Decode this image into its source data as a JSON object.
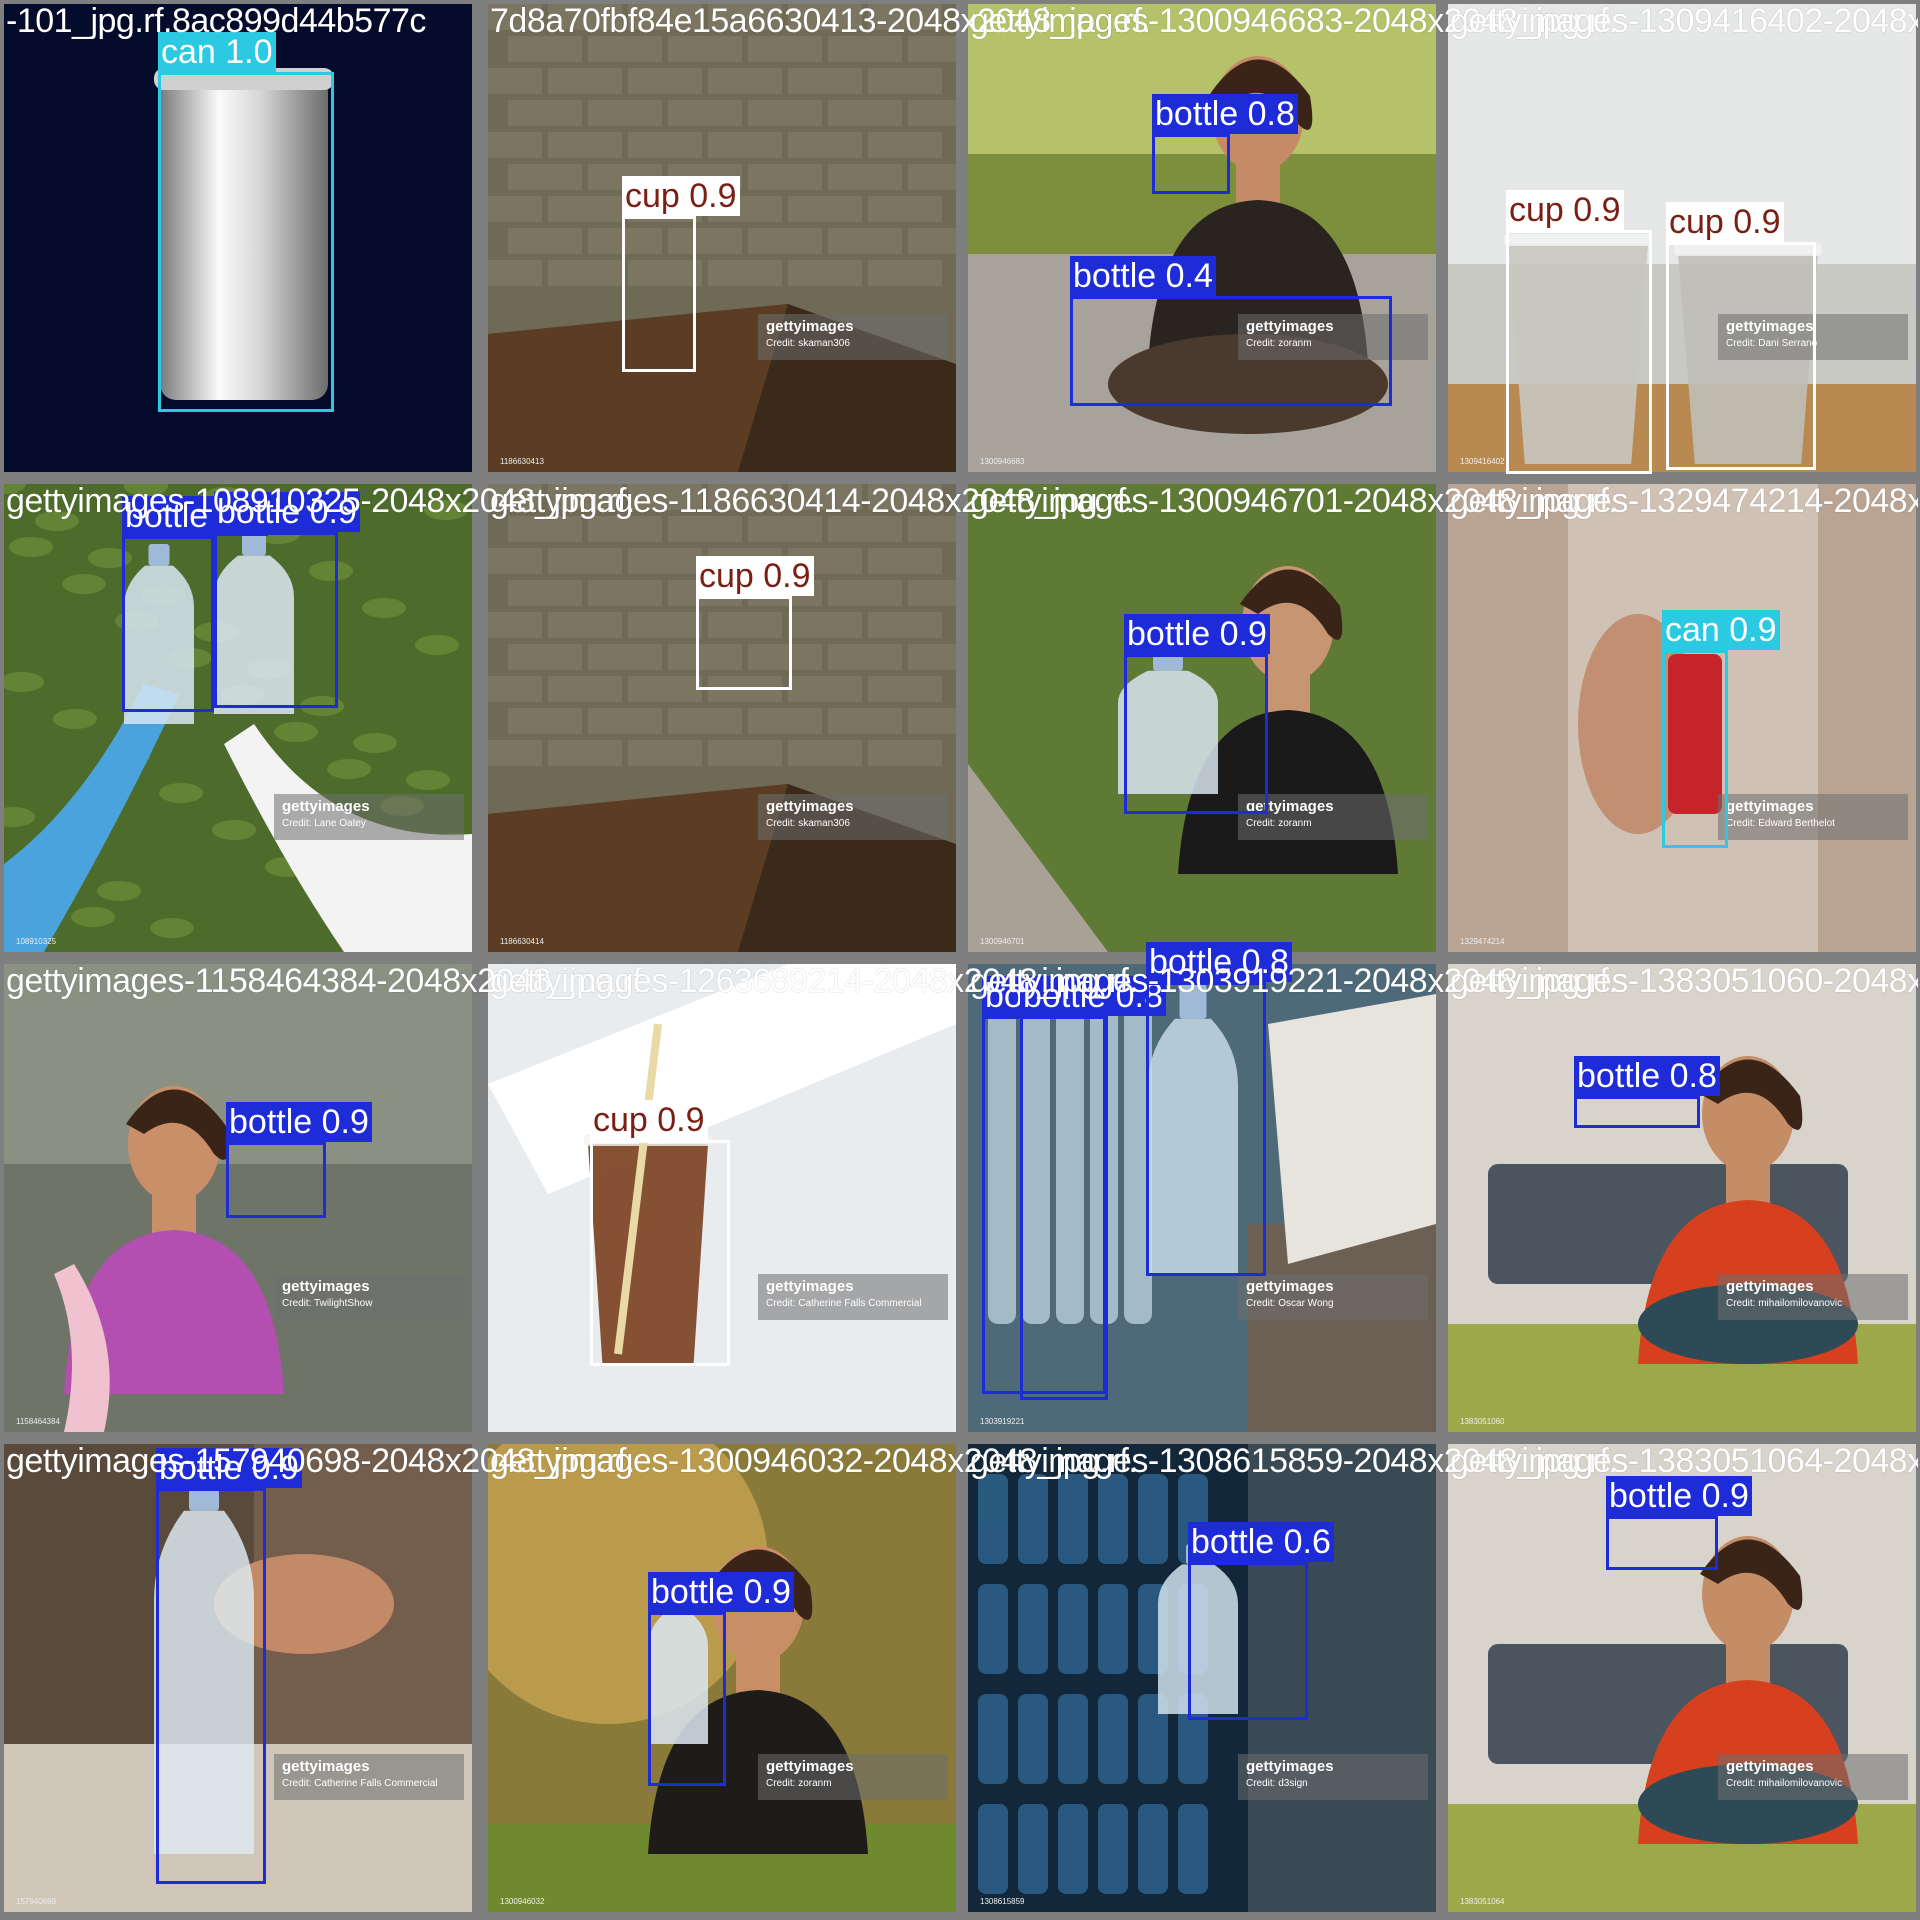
{
  "box_colors": {
    "bottle": "#1e2bd8",
    "cup": "#ffffff",
    "can": "#2cc9e2"
  },
  "label_text_colors": {
    "bottle": "#ffffff",
    "cup": "#7a1f14",
    "can": "#ffffff"
  },
  "tiles": [
    {
      "title": "-101_jpg.rf.8ac899d44b577c",
      "scene": "navy",
      "watermark": null,
      "detections": [
        {
          "cls": "can",
          "label": "can 1.0"
        }
      ]
    },
    {
      "title": "7d8a70fbf84e15a6630413-2048x2048_jpg.rf.",
      "scene": "brick-table",
      "watermark": {
        "brand": "gettyimages",
        "credit": "Credit: skaman306",
        "id": "1186630413"
      },
      "detections": [
        {
          "cls": "cup",
          "label": "cup 0.9"
        }
      ]
    },
    {
      "title": "gettyimages-1300946683-2048x2048_jpg.rf.",
      "scene": "park-sunset",
      "watermark": {
        "brand": "gettyimages",
        "credit": "Credit: zoranm",
        "id": "1300946683"
      },
      "detections": [
        {
          "cls": "bottle",
          "label": "bottle 0.8"
        },
        {
          "cls": "bottle",
          "label": "bottle 0.4"
        }
      ]
    },
    {
      "title": "gettyimages-1309416402-2048x2048_jpg.rf.",
      "scene": "window-cups",
      "watermark": {
        "brand": "gettyimages",
        "credit": "Credit: Dani Serrano",
        "id": "1309416402"
      },
      "detections": [
        {
          "cls": "cup",
          "label": "cup 0.9"
        },
        {
          "cls": "cup",
          "label": "cup 0.9"
        }
      ]
    },
    {
      "title": "gettyimages-108910325-2048x2048_jpg.rf.",
      "scene": "tea-field",
      "watermark": {
        "brand": "gettyimages",
        "credit": "Credit: Lane Oatey",
        "id": "108910325"
      },
      "detections": [
        {
          "cls": "bottle",
          "label": "bottle 0.9"
        },
        {
          "cls": "bottle",
          "label": "bottle 0.9"
        }
      ]
    },
    {
      "title": "gettyimages-1186630414-2048x2048_jpg.rf.",
      "scene": "brick-table",
      "watermark": {
        "brand": "gettyimages",
        "credit": "Credit: skaman306",
        "id": "1186630414"
      },
      "detections": [
        {
          "cls": "cup",
          "label": "cup 0.9"
        }
      ]
    },
    {
      "title": "gettyimages-1300946701-2048x2048_jpg.rf.",
      "scene": "park-green",
      "watermark": {
        "brand": "gettyimages",
        "credit": "Credit: zoranm",
        "id": "1300946701"
      },
      "detections": [
        {
          "cls": "bottle",
          "label": "bottle 0.9"
        }
      ]
    },
    {
      "title": "gettyimages-1329474214-2048x2048_jpg.rf.",
      "scene": "beige-blur",
      "watermark": {
        "brand": "gettyimages",
        "credit": "Credit: Edward Berthelot",
        "id": "1329474214"
      },
      "detections": [
        {
          "cls": "can",
          "label": "can 0.9"
        }
      ]
    },
    {
      "title": "gettyimages-1158464384-2048x2048_jpg.rf.",
      "scene": "outdoor-grey",
      "watermark": {
        "brand": "gettyimages",
        "credit": "Credit: TwilightShow",
        "id": "1158464384"
      },
      "detections": [
        {
          "cls": "bottle",
          "label": "bottle 0.9"
        }
      ]
    },
    {
      "title": "gettyimages-1263689214-2048x2048_jpg.rf.",
      "scene": "white-studio",
      "watermark": {
        "brand": "gettyimages",
        "credit": "Credit: Catherine Falls Commercial",
        "id": "1263689214"
      },
      "detections": [
        {
          "cls": "cup",
          "label": "cup 0.9"
        }
      ]
    },
    {
      "title": "gettyimages-1303919221-2048x2048_jpg.rf.",
      "scene": "store-shelf",
      "watermark": {
        "brand": "gettyimages",
        "credit": "Credit: Oscar Wong",
        "id": "1303919221"
      },
      "detections": [
        {
          "cls": "bottle",
          "label": "bottle 0.6"
        },
        {
          "cls": "bottle",
          "label": "bottle 0.8"
        },
        {
          "cls": "bottle",
          "label": "bottle 0.8"
        }
      ]
    },
    {
      "title": "gettyimages-1383051060-2048x2048_jpg.rf.",
      "scene": "living-room",
      "watermark": {
        "brand": "gettyimages",
        "credit": "Credit: mihailomilovanovic",
        "id": "1383051060"
      },
      "detections": [
        {
          "cls": "bottle",
          "label": "bottle 0.8"
        }
      ]
    },
    {
      "title": "gettyimages-157940698-2048x2048_jpg.rf.",
      "scene": "bar-blur",
      "watermark": {
        "brand": "gettyimages",
        "credit": "Credit: Catherine Falls Commercial",
        "id": "157940698"
      },
      "detections": [
        {
          "cls": "bottle",
          "label": "bottle 0.9"
        }
      ]
    },
    {
      "title": "gettyimages-1300946032-2048x2048_jpg.rf.",
      "scene": "park-golden",
      "watermark": {
        "brand": "gettyimages",
        "credit": "Credit: zoranm",
        "id": "1300946032"
      },
      "detections": [
        {
          "cls": "bottle",
          "label": "bottle 0.9"
        }
      ]
    },
    {
      "title": "gettyimages-1308615859-2048x2048_jpg.rf.",
      "scene": "store-dark",
      "watermark": {
        "brand": "gettyimages",
        "credit": "Credit: d3sign",
        "id": "1308615859"
      },
      "detections": [
        {
          "cls": "bottle",
          "label": "bottle 0.6"
        }
      ]
    },
    {
      "title": "gettyimages-1383051064-2048x2048_jpg.rf.",
      "scene": "living-room",
      "watermark": {
        "brand": "gettyimages",
        "credit": "Credit: mihailomilovanovic",
        "id": "1383051064"
      },
      "detections": [
        {
          "cls": "bottle",
          "label": "bottle 0.9"
        }
      ]
    }
  ]
}
